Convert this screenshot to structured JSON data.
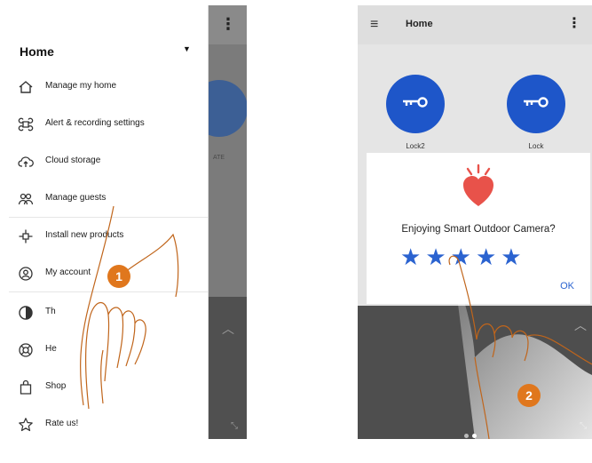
{
  "left_screen": {
    "drawer": {
      "title": "Home",
      "items": [
        {
          "label": "Manage my home",
          "icon": "house-icon"
        },
        {
          "label": "Alert & recording settings",
          "icon": "command-icon"
        },
        {
          "label": "Cloud storage",
          "icon": "cloud-upload-icon"
        },
        {
          "label": "Manage guests",
          "icon": "guests-icon"
        },
        {
          "label": "Install new products",
          "icon": "plug-icon"
        },
        {
          "label": "My account",
          "icon": "account-icon"
        },
        {
          "label": "Th",
          "icon": "theme-icon"
        },
        {
          "label": "He",
          "icon": "help-icon"
        },
        {
          "label": "Shop",
          "icon": "shop-bag-icon"
        },
        {
          "label": "Rate us!",
          "icon": "star-outline-icon"
        }
      ]
    },
    "step_badge": "1"
  },
  "right_screen": {
    "header_title": "Home",
    "locks": [
      {
        "label": "Lock2"
      },
      {
        "label": "Lock"
      }
    ],
    "dialog": {
      "message": "Enjoying Smart Outdoor Camera?",
      "rating_stars": 5,
      "ok_label": "OK"
    },
    "step_badge": "2"
  },
  "colors": {
    "accent_blue": "#2b63d0",
    "lock_blue": "#1e56c9",
    "badge_orange": "#e0771d",
    "heart_red": "#e8524a"
  }
}
